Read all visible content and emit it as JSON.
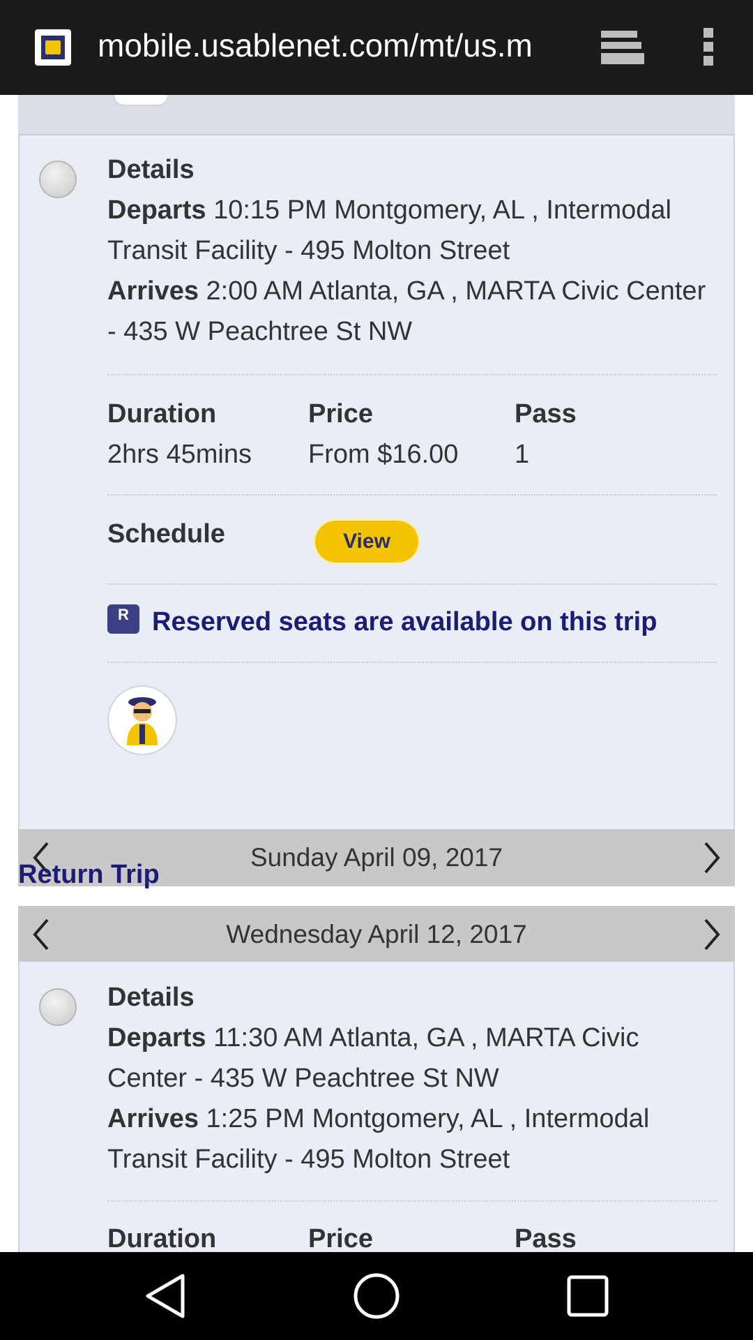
{
  "browser": {
    "url": "mobile.usablenet.com/mt/us.m"
  },
  "trip1": {
    "details_label": "Details",
    "departs_label": "Departs",
    "departs_text": "10:15 PM Montgomery, AL , Intermodal Transit Facility - 495 Molton Street",
    "arrives_label": "Arrives",
    "arrives_text": "2:00 AM Atlanta, GA , MARTA Civic Center - 435 W Peachtree St NW",
    "duration_label": "Duration",
    "duration_value": "2hrs 45mins",
    "price_label": "Price",
    "price_value": "From $16.00",
    "pass_label": "Pass",
    "pass_value": "1",
    "schedule_label": "Schedule",
    "view_button": "View",
    "reserved_badge": "R",
    "reserved_text": "Reserved seats are available on this trip"
  },
  "outbound_date": "Sunday April 09, 2017",
  "return_trip_title": "Return Trip",
  "return_date": "Wednesday April 12, 2017",
  "trip2": {
    "details_label": "Details",
    "departs_label": "Departs",
    "departs_text": "11:30 AM Atlanta, GA , MARTA Civic Center - 435 W Peachtree St NW",
    "arrives_label": "Arrives",
    "arrives_text": "1:25 PM Montgomery, AL , Intermodal Transit Facility - 495 Molton Street",
    "duration_label": "Duration",
    "price_label": "Price",
    "pass_label": "Pass"
  },
  "colors": {
    "accent_navy": "#1c1c75",
    "button_yellow": "#f5c400",
    "panel_bg": "#e9edf5",
    "datebar_bg": "#c8c8c8"
  }
}
